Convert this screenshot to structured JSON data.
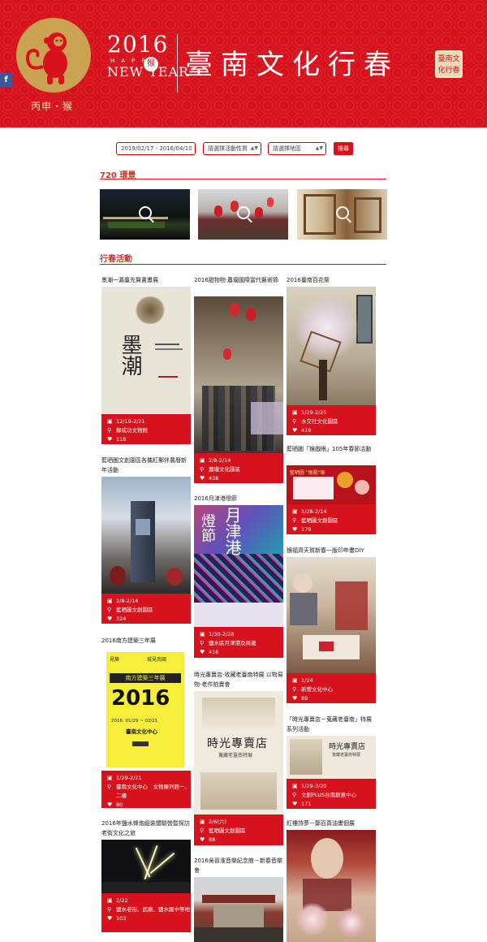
{
  "header": {
    "facebook_label": "f",
    "logo_caption": "丙申・猴",
    "year": "2016",
    "happy": "HAPPY",
    "happy_seal": "猴",
    "new_year": "NEW YEAR",
    "site_title": "臺南文化行春",
    "seal_text": "臺南文化行春"
  },
  "filter": {
    "date_range": "2019/02/17 - 2016/04/10",
    "type_select": "請選擇活動性質",
    "area_select": "請選擇地區",
    "search_button": "搜尋"
  },
  "sections": {
    "panorama_title": "720 環景",
    "events_title": "行春活動"
  },
  "events": [
    {
      "title": "墨潮一瀛臺先賢書畫展",
      "date": "12/19-2/21",
      "place": "鄭成功文物館",
      "likes": "118"
    },
    {
      "title": "藍晒圖文創園區各攜紅郵伴農曆新年活動",
      "date": "2/8-2/14",
      "place": "藍晒圖文創園區",
      "likes": "324"
    },
    {
      "title": "2016南方建築三年展",
      "date": "1/29-2/21",
      "place": "臺南文化中心　文物陳列館一、二樓",
      "likes": "80"
    },
    {
      "title": "2016年鹽水蜂炮組裝體驗營暨探訪老街文化之旅",
      "date": "2/22",
      "place": "鹽水老街、武廟、鹽水國中等地",
      "likes": "103"
    },
    {
      "title": "2016甜物物‧蕭壠國際當代藝術節",
      "date": "2/8-2/14",
      "place": "蕭壠文化園區",
      "likes": "438"
    },
    {
      "title": "2016月津港燈節",
      "date": "1/30-2/28",
      "place": "鹽水區月津港及周邊",
      "likes": "416"
    },
    {
      "title": "時光專賣店-收藏老臺南特展 以物易物-老件拍賣會",
      "date": "2/6(六)",
      "place": "藍晒圖文創園區",
      "likes": "88"
    },
    {
      "title": "2016吳晉淮音樂紀念館－新春音樂會",
      "date": "",
      "place": "",
      "likes": ""
    },
    {
      "title": "2016臺南百花祭",
      "date": "1/29-2/25",
      "place": "水交社文化園區",
      "likes": "419"
    },
    {
      "title": "藍晒圖「猴戲眼」105年春節活動",
      "date": "1/28-2/14",
      "place": "藍晒圖文創園區",
      "likes": "179"
    },
    {
      "title": "猴福齊天賀新春一版印年畫DIY",
      "date": "1/24",
      "place": "新營文化中心",
      "likes": "89"
    },
    {
      "title": "「時光專賣店－蒐藏老臺南」特展系列活動",
      "date": "1/29-3/20",
      "place": "文創PLUS台南創意中心",
      "likes": "171"
    },
    {
      "title": "紅樓詩夢－鄭百真油畫個展",
      "date": "",
      "place": "",
      "likes": ""
    }
  ],
  "posters": {
    "ink_title": "墨潮",
    "arch_top1": "見築",
    "arch_top2": "城見南國",
    "arch_banner": "南方建築三年展",
    "arch_year": "2016",
    "arch_date": "2016. 01/29 ~ 02/21",
    "arch_place": "臺南文化中心",
    "lantern_t1": "燈節",
    "lantern_t2": "月津港",
    "shop_title": "時光專賣店",
    "shop_sub": "蒐藏老臺南特展",
    "monkey_title": "藍晒圖 \"猴戲\"眼"
  },
  "colors": {
    "brand_red": "#d8121c",
    "gold": "#c9a352"
  }
}
